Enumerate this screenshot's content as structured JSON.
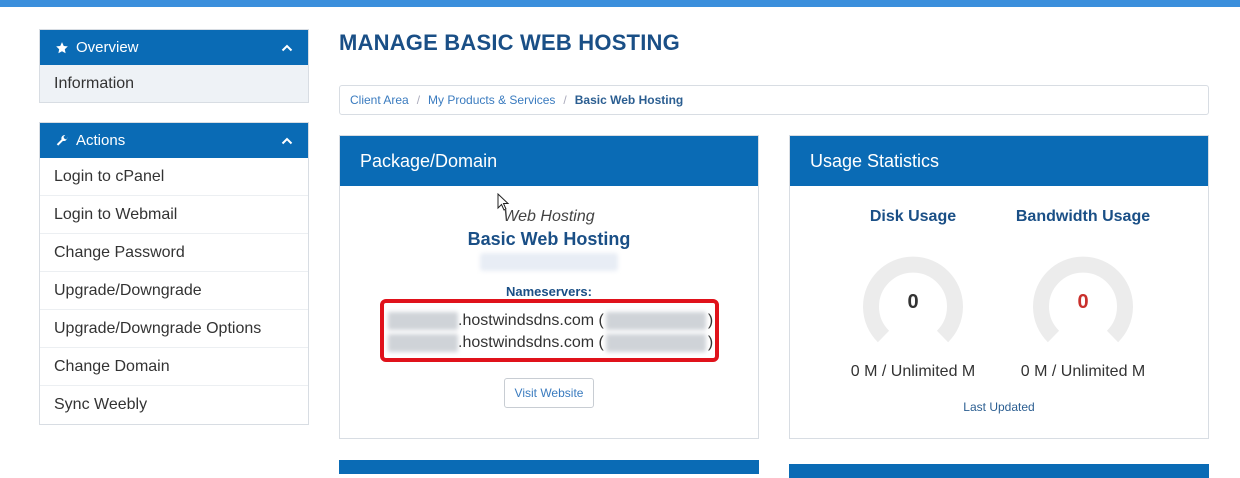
{
  "sidebar": {
    "overview": {
      "title": "Overview",
      "items": [
        {
          "label": "Information"
        }
      ]
    },
    "actions": {
      "title": "Actions",
      "items": [
        {
          "label": "Login to cPanel"
        },
        {
          "label": "Login to Webmail"
        },
        {
          "label": "Change Password"
        },
        {
          "label": "Upgrade/Downgrade"
        },
        {
          "label": "Upgrade/Downgrade Options"
        },
        {
          "label": "Change Domain"
        },
        {
          "label": "Sync Weebly"
        }
      ]
    }
  },
  "page": {
    "title": "MANAGE BASIC WEB HOSTING"
  },
  "breadcrumb": [
    {
      "label": "Client Area"
    },
    {
      "label": "My Products & Services"
    },
    {
      "label": "Basic Web Hosting"
    }
  ],
  "package": {
    "header": "Package/Domain",
    "type": "Web Hosting",
    "name": "Basic Web Hosting",
    "nameservers_label": "Nameservers:",
    "nameservers": [
      {
        "suffix": ".hostwindsdns.com (",
        "close": ")"
      },
      {
        "suffix": ".hostwindsdns.com (",
        "close": ")"
      }
    ],
    "visit_label": "Visit Website"
  },
  "usage": {
    "header": "Usage Statistics",
    "disk": {
      "title": "Disk Usage",
      "value": "0",
      "text": "0 M / Unlimited M"
    },
    "bandwidth": {
      "title": "Bandwidth Usage",
      "value": "0",
      "text": "0 M / Unlimited M"
    },
    "last_updated": "Last Updated"
  },
  "colors": {
    "primary": "#0a6bb5",
    "highlight": "#e0121b",
    "gauge": "#ececec",
    "alert": "#c9302c"
  }
}
